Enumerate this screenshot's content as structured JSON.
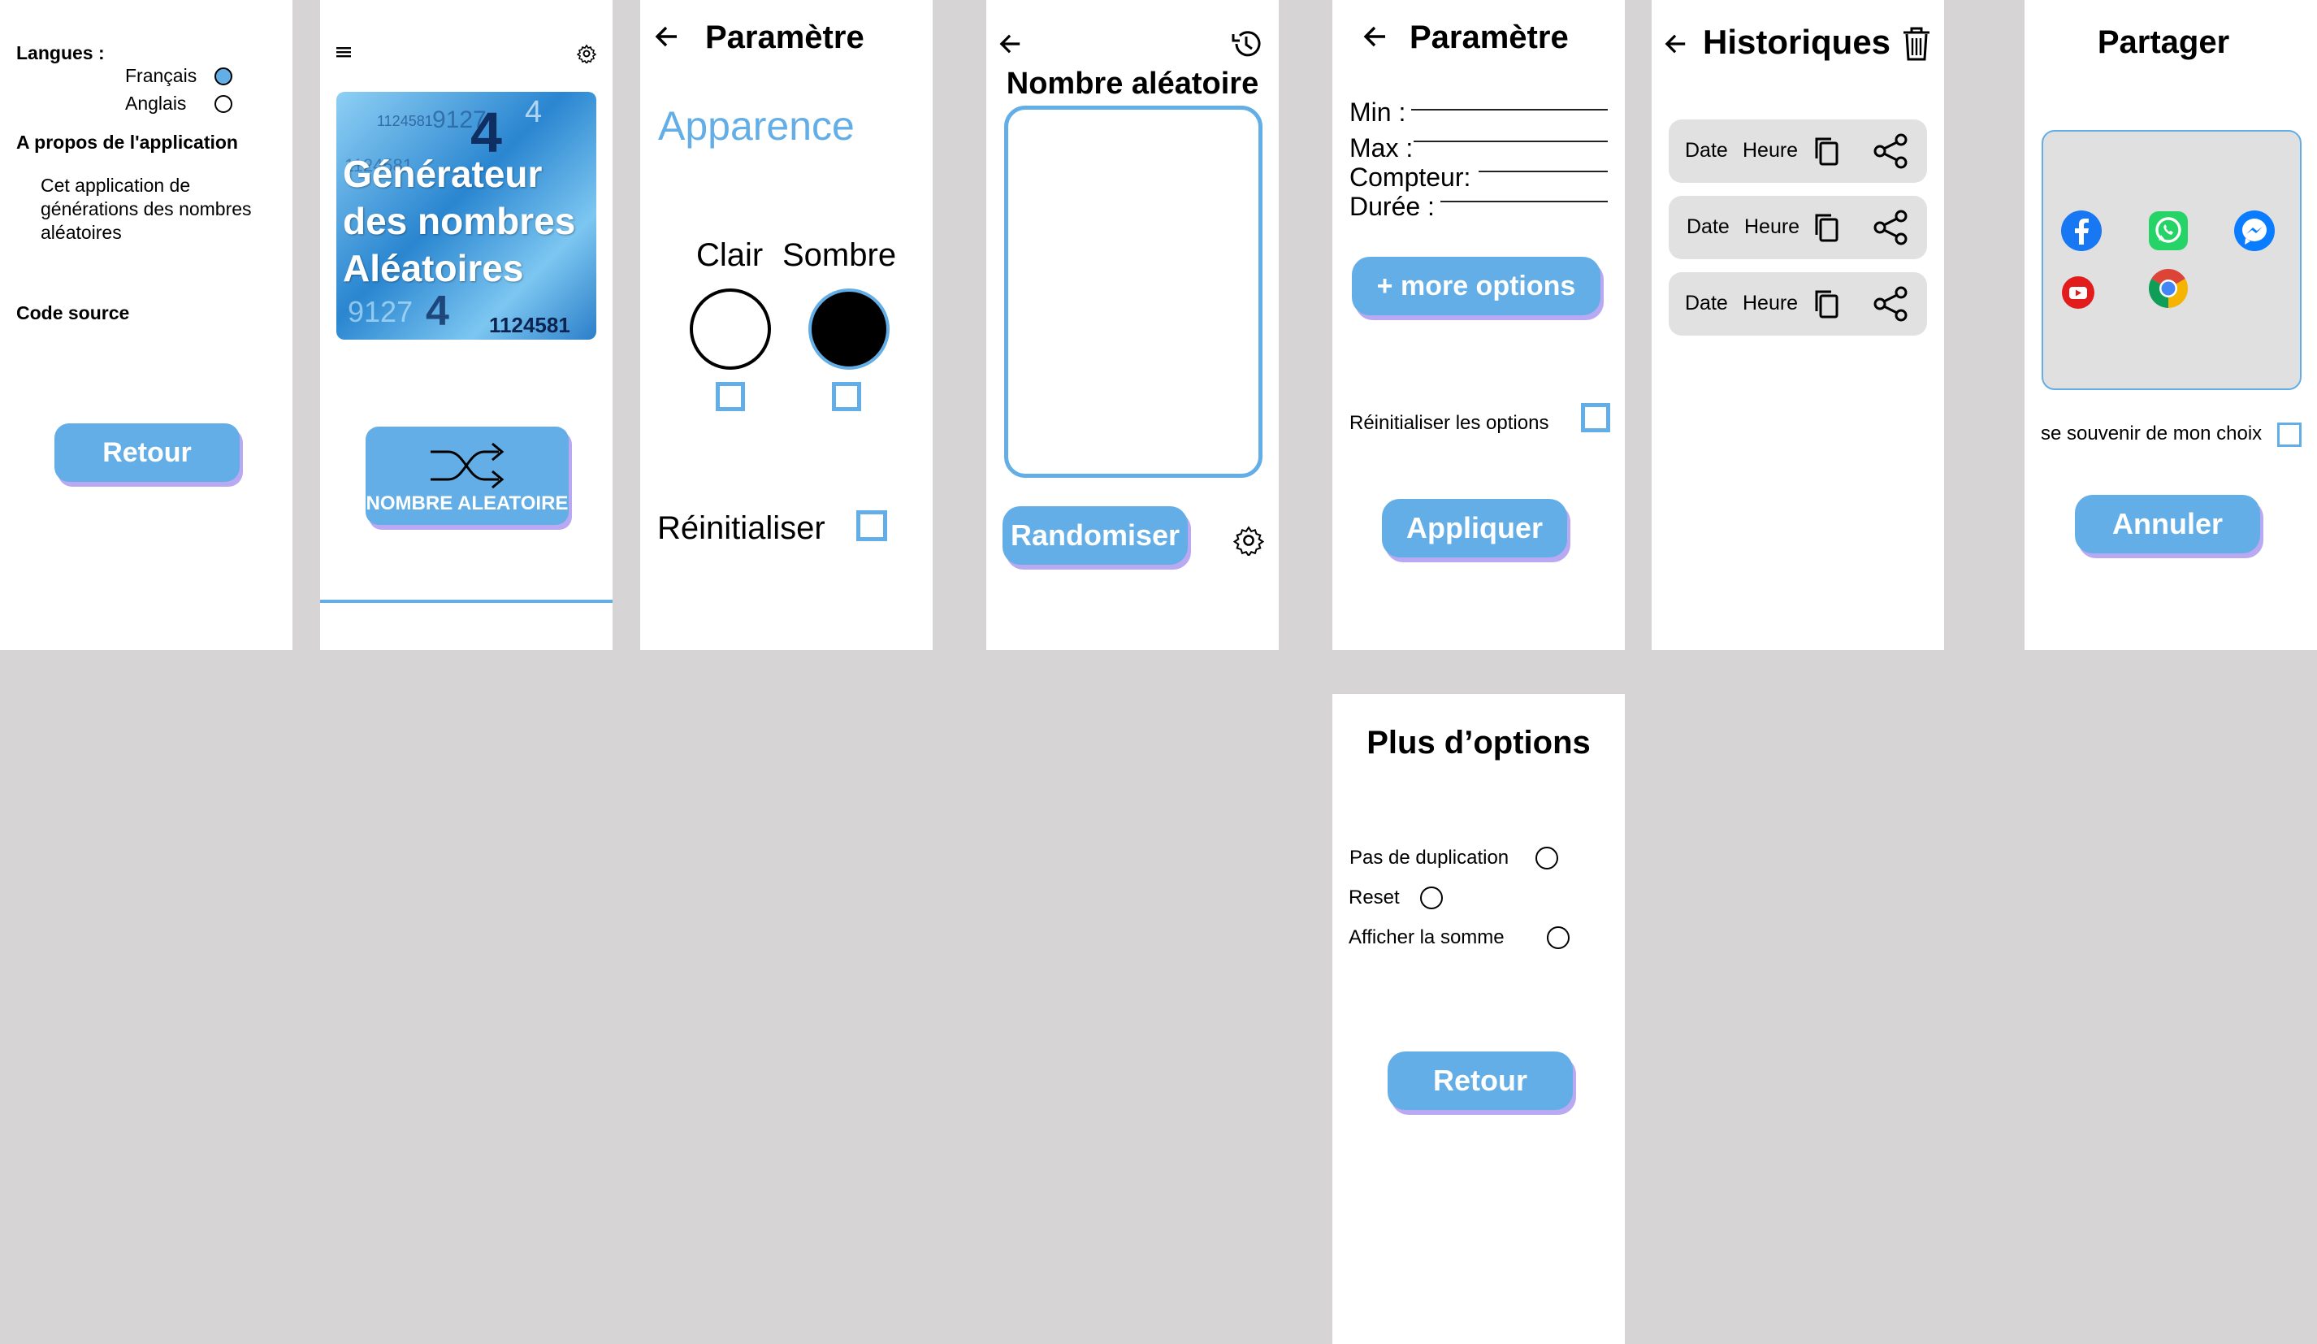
{
  "screen_about": {
    "languages_label": "Langues :",
    "lang_options": [
      "Français",
      "Anglais"
    ],
    "about_title": "A propos de l'application",
    "about_text_lines": [
      "Cet application de",
      "générations des nombres",
      "aléatoires"
    ],
    "source_label": "Code source",
    "back_button": "Retour"
  },
  "screen_home": {
    "banner_lines": [
      "Générateur",
      "des nombres",
      "Aléatoires"
    ],
    "banner_bg_numbers": [
      "1124581",
      "9127",
      "4",
      "4",
      "1124581",
      "9127",
      "4",
      "1124581"
    ],
    "random_button": "NOMBRE ALEATOIRE"
  },
  "screen_settings_appearance": {
    "title": "Paramètre",
    "section": "Apparence",
    "light_label": "Clair",
    "dark_label": "Sombre",
    "reset_label": "Réinitialiser"
  },
  "screen_random": {
    "title": "Nombre aléatoire",
    "randomize_button": "Randomiser"
  },
  "screen_settings_params": {
    "title": "Paramètre",
    "fields": [
      "Min :",
      "Max :",
      "Compteur:",
      "Durée :"
    ],
    "more_options_button": "+ more options",
    "reset_options_label": "Réinitialiser les options",
    "apply_button": "Appliquer"
  },
  "screen_history": {
    "title": "Historiques",
    "rows": [
      {
        "date": "Date",
        "time": "Heure"
      },
      {
        "date": "Date",
        "time": "Heure"
      },
      {
        "date": "Date",
        "time": "Heure"
      }
    ]
  },
  "screen_share": {
    "title": "Partager",
    "apps": [
      "facebook-icon",
      "whatsapp-icon",
      "messenger-icon",
      "youtube-icon",
      "chrome-icon"
    ],
    "remember_label": "se souvenir de mon choix",
    "cancel_button": "Annuler"
  },
  "screen_more_options": {
    "title": "Plus d’options",
    "options": [
      "Pas de duplication",
      "Reset",
      "Afficher la somme"
    ],
    "back_button": "Retour"
  },
  "colors": {
    "accent": "#63aee6",
    "shadow": "#b9a8f2",
    "canvas": "#d6d4d5",
    "history_row": "#e1e1e1"
  }
}
